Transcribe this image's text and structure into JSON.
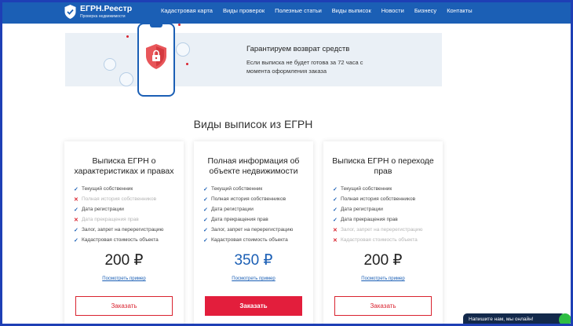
{
  "header": {
    "logo_name": "ЕГРН.Реестр",
    "logo_sub": "Проверка недвижимости",
    "nav": [
      "Кадастровая карта",
      "Виды проверок",
      "Полезные статьи",
      "Виды выписок",
      "Новости",
      "Бизнесу",
      "Контакты"
    ]
  },
  "banner": {
    "title": "Гарантируем возврат средств",
    "text": "Если выписка не будет готова за 72 часа с момента оформления заказа"
  },
  "section_title": "Виды выписок из ЕГРН",
  "cards": [
    {
      "title": "Выписка ЕГРН о характеристиках и правах",
      "features": [
        {
          "text": "Текущий собственник",
          "included": true
        },
        {
          "text": "Полная история собственников",
          "included": false
        },
        {
          "text": "Дата регистрации",
          "included": true
        },
        {
          "text": "Дата прекращения прав",
          "included": false
        },
        {
          "text": "Залог, запрет на перерегистрацию",
          "included": true
        },
        {
          "text": "Кадастровая стоимость объекта",
          "included": true
        }
      ],
      "price": "200 ₽",
      "example_link": "Посмотреть пример",
      "order_label": "Заказать"
    },
    {
      "title": "Полная информация об объекте недвижимости",
      "features": [
        {
          "text": "Текущий собственник",
          "included": true
        },
        {
          "text": "Полная история собственников",
          "included": true
        },
        {
          "text": "Дата регистрации",
          "included": true
        },
        {
          "text": "Дата прекращения прав",
          "included": true
        },
        {
          "text": "Залог, запрет на перерегистрацию",
          "included": true
        },
        {
          "text": "Кадастровая стоимость объекта",
          "included": true
        }
      ],
      "price": "350 ₽",
      "example_link": "Посмотреть пример",
      "order_label": "Заказать"
    },
    {
      "title": "Выписка ЕГРН о переходе прав",
      "features": [
        {
          "text": "Текущий собственник",
          "included": true
        },
        {
          "text": "Полная история собственников",
          "included": true
        },
        {
          "text": "Дата регистрации",
          "included": true
        },
        {
          "text": "Дата прекращения прав",
          "included": true
        },
        {
          "text": "Залог, запрет на перерегистрацию",
          "included": false
        },
        {
          "text": "Кадастровая стоимость объекта",
          "included": false
        }
      ],
      "price": "200 ₽",
      "example_link": "Посмотреть пример",
      "order_label": "Заказать"
    }
  ],
  "chat_label": "Напишите нам, мы онлайн!",
  "colors": {
    "brand_blue": "#1b5fb5",
    "accent_red": "#e31e3c",
    "chat_bg": "#13294b",
    "frame": "#1e3fb5"
  },
  "icons": [
    "logo-shield-icon",
    "phone-illustration",
    "shield-lock-icon",
    "check-icon",
    "cross-icon",
    "chat-icon"
  ]
}
